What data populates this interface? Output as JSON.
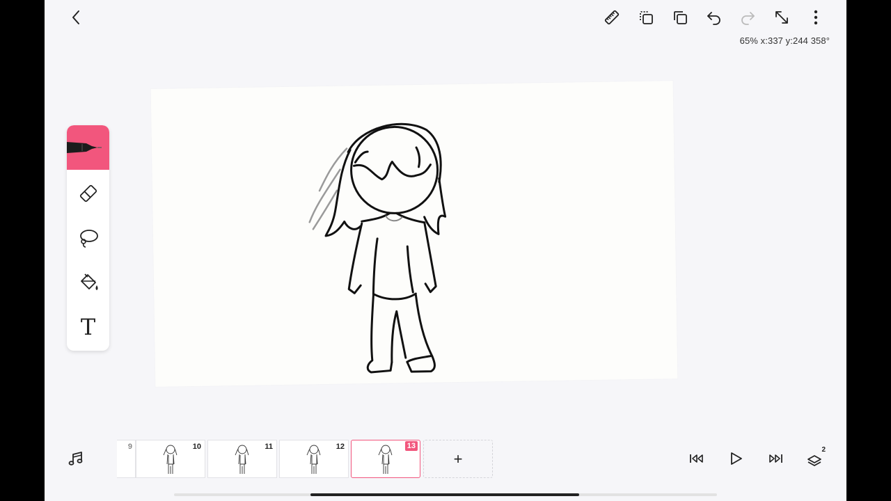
{
  "app": {
    "accent_color": "#f2567d",
    "background_color": "#f6f6f9"
  },
  "top_bar": {
    "back_icon": "chevron-left-icon",
    "actions": [
      "ruler-icon",
      "copy-frame-icon",
      "duplicate-icon",
      "undo-icon",
      "redo-icon",
      "fit-screen-icon",
      "more-vertical-icon"
    ],
    "status": "65% x:337 y:244 358°"
  },
  "tools": [
    {
      "name": "pen",
      "icon": "pen-icon",
      "active": true
    },
    {
      "name": "eraser",
      "icon": "eraser-icon",
      "active": false
    },
    {
      "name": "lasso",
      "icon": "lasso-icon",
      "active": false
    },
    {
      "name": "fill",
      "icon": "paint-bucket-icon",
      "active": false
    },
    {
      "name": "text",
      "icon": "text-icon",
      "label": "T",
      "active": false
    }
  ],
  "timeline": {
    "frames": [
      {
        "number": "9"
      },
      {
        "number": "10"
      },
      {
        "number": "11"
      },
      {
        "number": "12"
      },
      {
        "number": "13",
        "active": true
      }
    ],
    "add_label": "+"
  },
  "playback": [
    "skip-back-icon",
    "play-icon",
    "skip-forward-icon",
    "layers-icon"
  ],
  "layers_count": "2"
}
